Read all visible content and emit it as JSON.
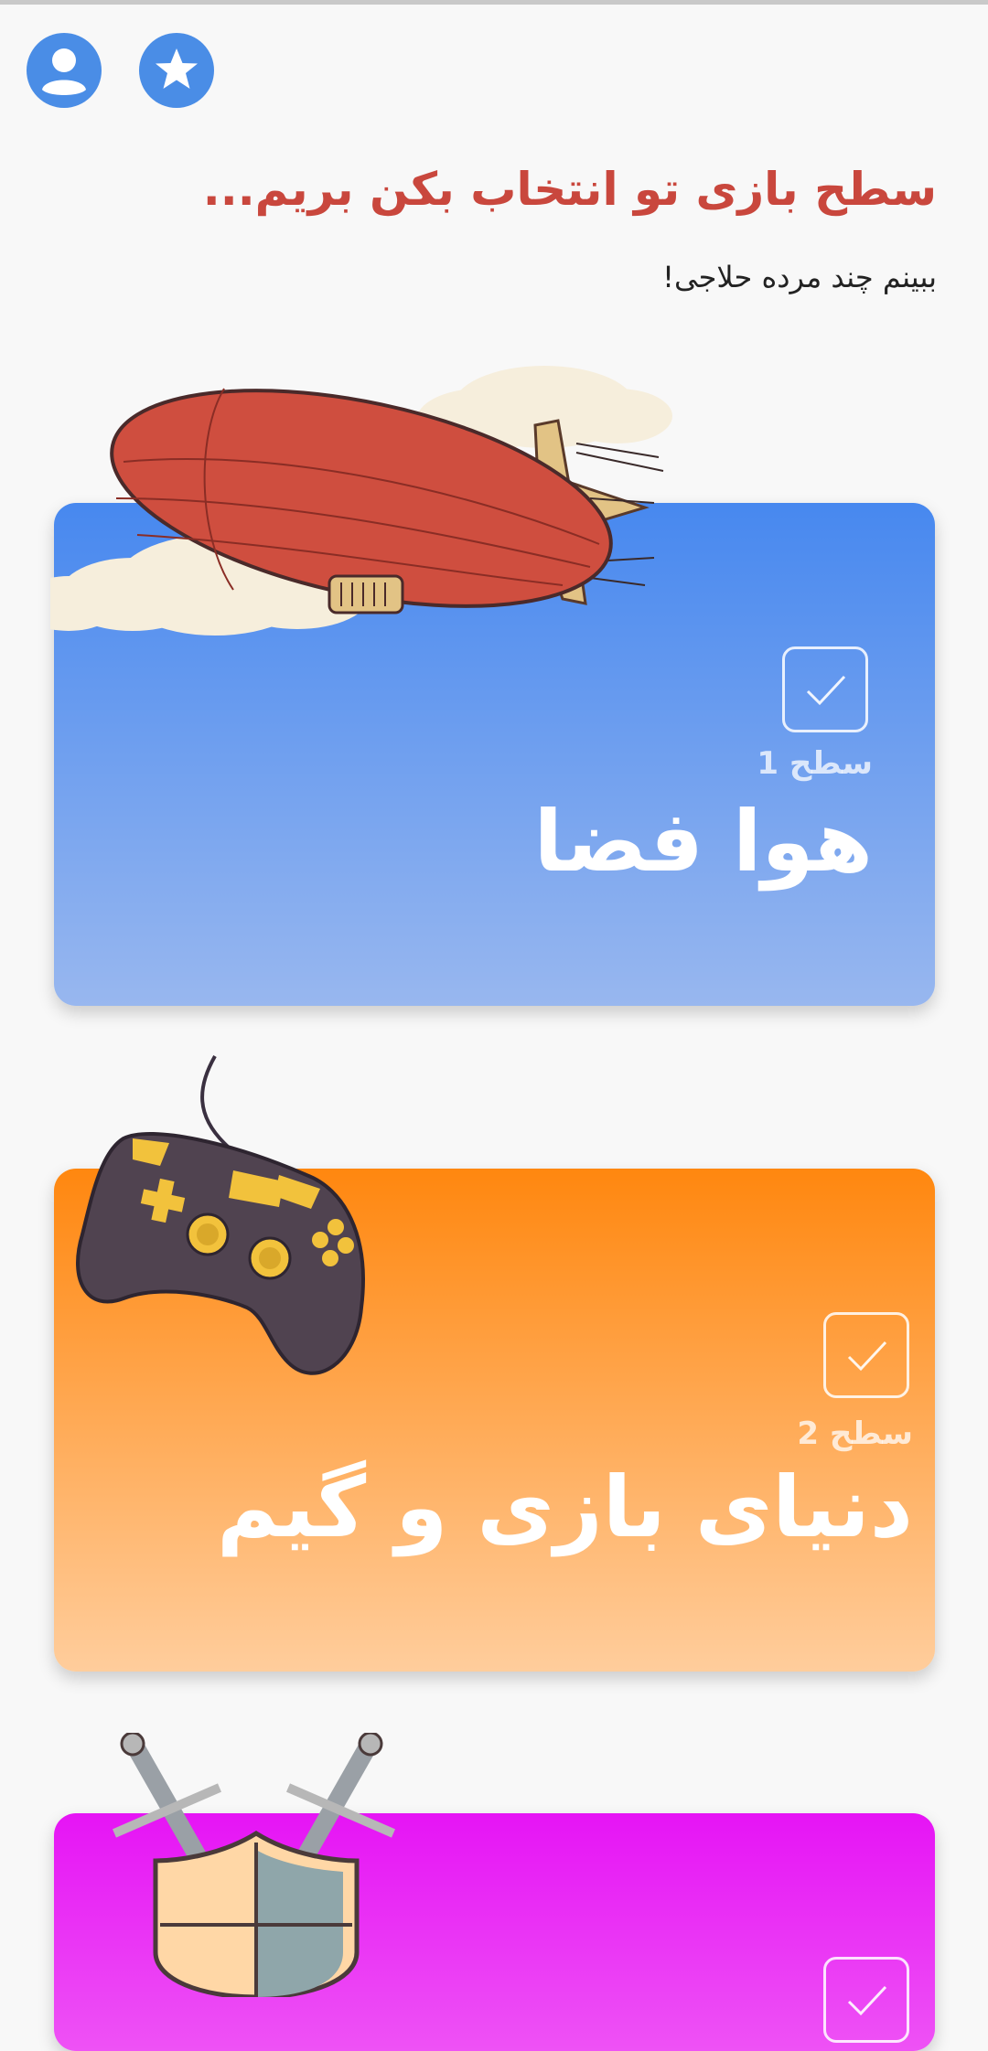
{
  "header": {
    "profile_icon": "account-circle-icon",
    "favorites_icon": "star-circle-icon",
    "accent_color": "#4a8de6"
  },
  "title": "سطح بازی تو انتخاب بکن بریم...",
  "subtitle": "ببینم چند مرده حلاجی!",
  "levels": [
    {
      "label": "سطح 1",
      "name": "هوا فضا",
      "color_top": "#4788ef",
      "color_bottom": "#98b7ef",
      "illustration": "airship"
    },
    {
      "label": "سطح 2",
      "name": "دنیای بازی و گیم",
      "color_top": "#ff870f",
      "color_bottom": "#ffcd9c",
      "illustration": "gamepad"
    },
    {
      "color_top": "#e614f5",
      "illustration": "shield-and-swords"
    }
  ]
}
